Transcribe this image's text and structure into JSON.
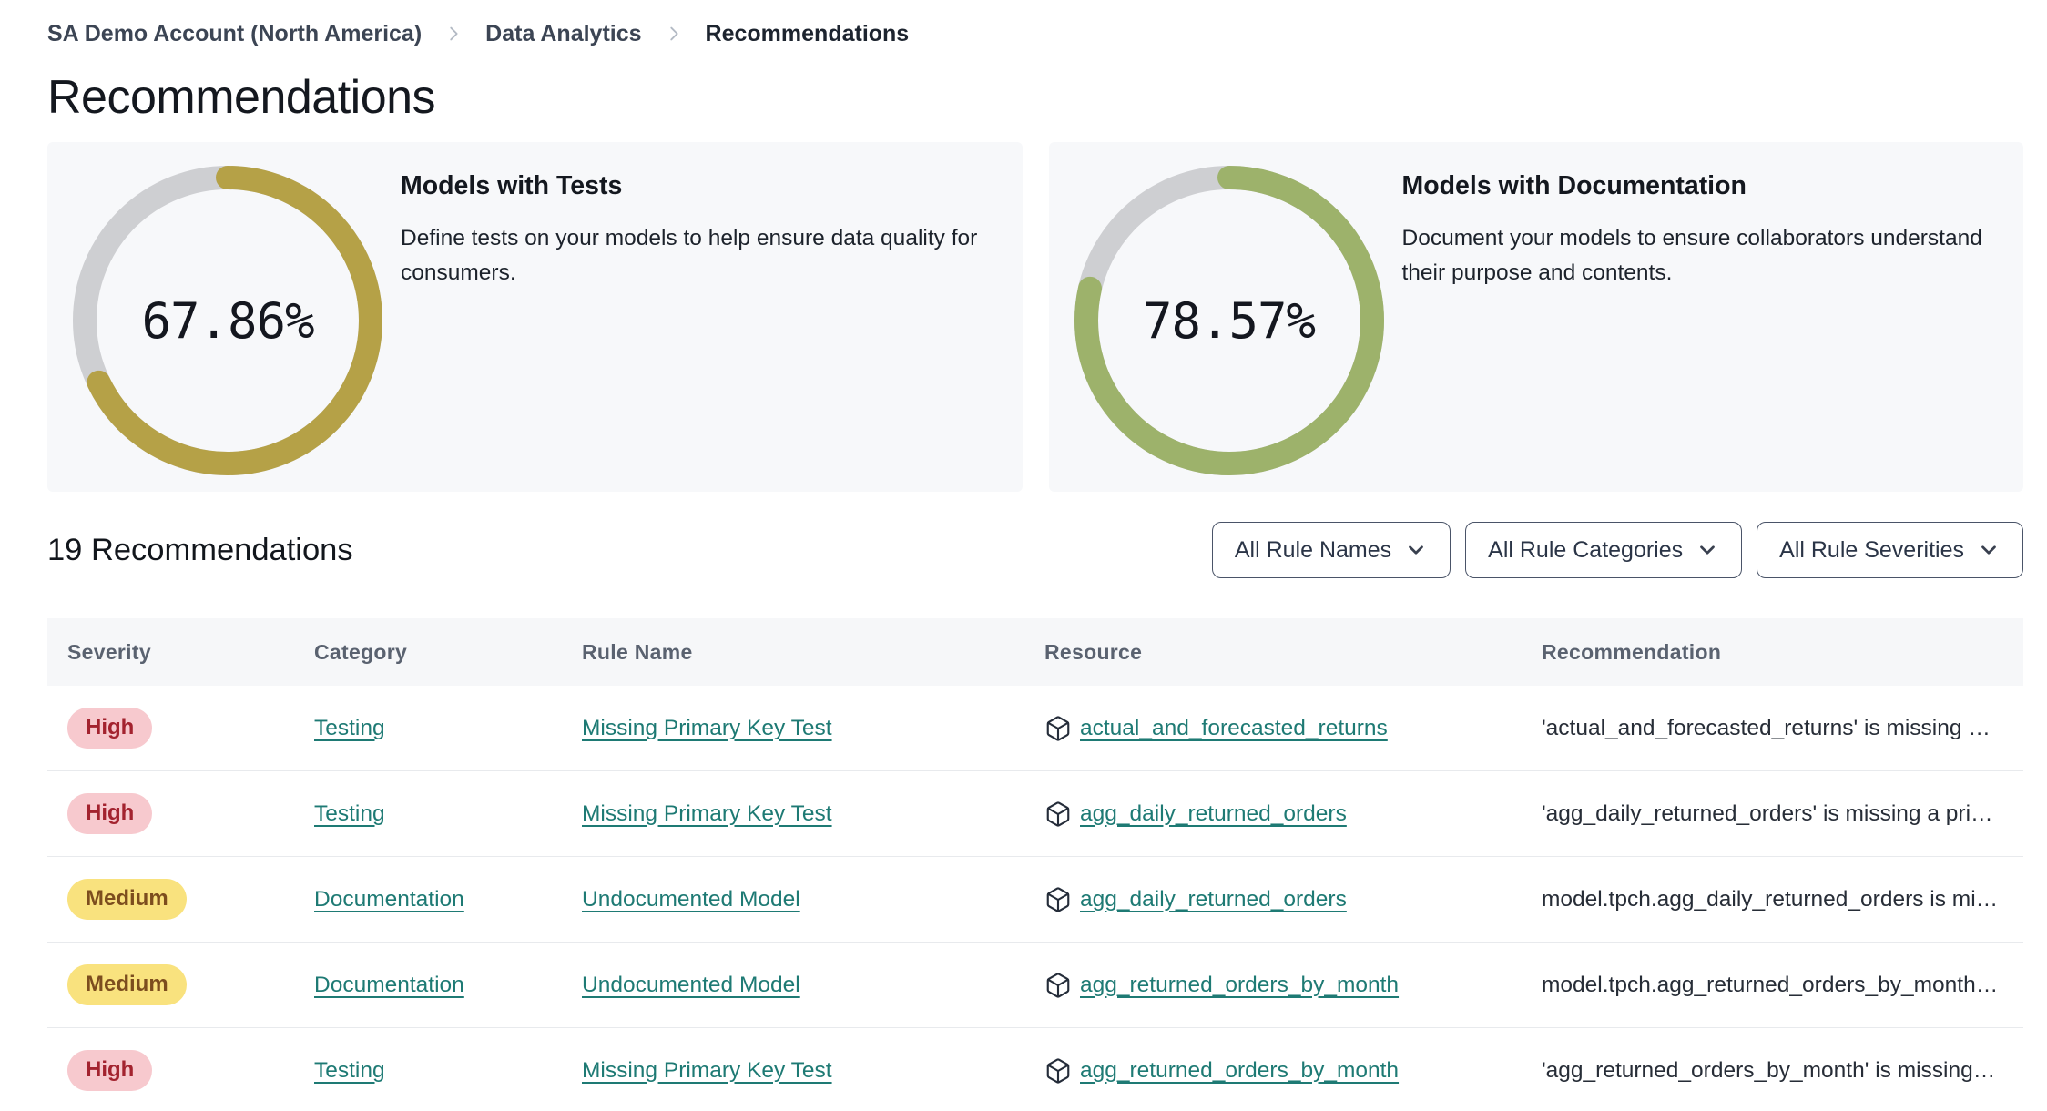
{
  "breadcrumb": {
    "items": [
      {
        "label": "SA Demo Account (North America)"
      },
      {
        "label": "Data Analytics"
      },
      {
        "label": "Recommendations"
      }
    ],
    "separator_icon": "chevron-right"
  },
  "page": {
    "title": "Recommendations"
  },
  "summary_cards": [
    {
      "percent": "67.86%",
      "value": 67.86,
      "title": "Models with Tests",
      "description": "Define tests on your models to help ensure data quality for consumers.",
      "accent_color": "#b5a147",
      "track_color": "#cecfd2",
      "chart_type": "donut"
    },
    {
      "percent": "78.57%",
      "value": 78.57,
      "title": "Models with Documentation",
      "description": "Document your models to ensure collaborators understand their purpose and contents.",
      "accent_color": "#9db26b",
      "track_color": "#cecfd2",
      "chart_type": "donut"
    }
  ],
  "list_header": {
    "title": "19 Recommendations",
    "count": 19,
    "filters": [
      {
        "label": "All Rule Names",
        "icon": "chevron-down"
      },
      {
        "label": "All Rule Categories",
        "icon": "chevron-down"
      },
      {
        "label": "All Rule Severities",
        "icon": "chevron-down"
      }
    ]
  },
  "table": {
    "columns": [
      "Severity",
      "Category",
      "Rule Name",
      "Resource",
      "Recommendation"
    ],
    "resource_icon": "cube",
    "rows": [
      {
        "severity": "High",
        "severity_level": "high",
        "category": "Testing",
        "rule_name": "Missing Primary Key Test",
        "resource": "actual_and_forecasted_returns",
        "recommendation": "'actual_and_forecasted_returns' is missing a …"
      },
      {
        "severity": "High",
        "severity_level": "high",
        "category": "Testing",
        "rule_name": "Missing Primary Key Test",
        "resource": "agg_daily_returned_orders",
        "recommendation": "'agg_daily_returned_orders' is missing a prim…"
      },
      {
        "severity": "Medium",
        "severity_level": "medium",
        "category": "Documentation",
        "rule_name": "Undocumented Model",
        "resource": "agg_daily_returned_orders",
        "recommendation": "model.tpch.agg_daily_returned_orders is mis…"
      },
      {
        "severity": "Medium",
        "severity_level": "medium",
        "category": "Documentation",
        "rule_name": "Undocumented Model",
        "resource": "agg_returned_orders_by_month",
        "recommendation": "model.tpch.agg_returned_orders_by_month …"
      },
      {
        "severity": "High",
        "severity_level": "high",
        "category": "Testing",
        "rule_name": "Missing Primary Key Test",
        "resource": "agg_returned_orders_by_month",
        "recommendation": "'agg_returned_orders_by_month' is missing …"
      }
    ]
  },
  "colors": {
    "card_background": "#f7f8fa",
    "table_header_background": "#f6f7f9",
    "link_teal": "#1e7a74",
    "badge_high_bg": "#f7c9ce",
    "badge_high_text": "#a3232f",
    "badge_medium_bg": "#f9e27e",
    "badge_medium_text": "#7c4d1e"
  }
}
